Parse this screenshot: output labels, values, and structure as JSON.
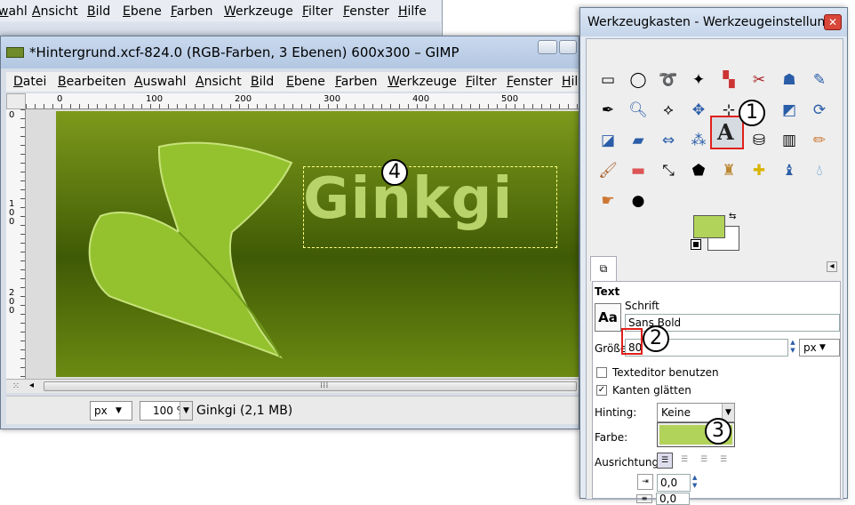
{
  "bg_window": {
    "menu": [
      "wahl",
      "Ansicht",
      "Bild",
      "Ebene",
      "Farben",
      "Werkzeuge",
      "Filter",
      "Fenster",
      "Hilfe"
    ]
  },
  "image_window": {
    "title": "*Hintergrund.xcf-824.0 (RGB-Farben, 3 Ebenen) 600x300 – GIMP",
    "menu": [
      "Datei",
      "Bearbeiten",
      "Auswahl",
      "Ansicht",
      "Bild",
      "Ebene",
      "Farben",
      "Werkzeuge",
      "Filter",
      "Fenster",
      "Hil"
    ],
    "ruler_h": [
      "0",
      "100",
      "200",
      "300",
      "400",
      "500"
    ],
    "ruler_v": [
      "0",
      "1\n0\n0",
      "2\n0\n0"
    ],
    "canvas_text": "Ginkgi",
    "status": {
      "unit": "px",
      "zoom": "100 %",
      "info": "Ginkgi (2,1 MB)"
    },
    "colors": {
      "canvas_top": "#7d9a1c",
      "canvas_dark": "#3f5a05",
      "text": "#b8d36a"
    }
  },
  "toolbox": {
    "title": "Werkzeugkasten - Werkzeugeinstellun...",
    "close": "✕",
    "tools": [
      "rect-select",
      "ellipse-select",
      "free-select",
      "fuzzy-select",
      "color-select",
      "scissors",
      "foreground-select",
      "paths",
      "color-picker",
      "zoom",
      "measure",
      "move",
      "align",
      "text",
      "bucket-fill",
      "blend",
      "pencil",
      "paintbrush",
      "eraser",
      "airbrush",
      "ink",
      "clone",
      "heal",
      "perspective-clone",
      "smudge",
      "dodge-burn",
      "crop",
      "rotate",
      "scale",
      "shear",
      "perspective",
      "flip",
      "cage"
    ],
    "fg_color": "#b2d35a",
    "bg_color": "#ffffff",
    "options": {
      "section": "Text",
      "font_label": "Schrift",
      "font_preview": "Aa",
      "font_value": "Sans Bold",
      "size_label": "Größe",
      "size_value": "80",
      "size_unit": "px",
      "editor_label": "Texteditor benutzen",
      "editor_checked": false,
      "antialias_label": "Kanten glätten",
      "antialias_checked": true,
      "hinting_label": "Hinting:",
      "hinting_value": "Keine",
      "color_label": "Farbe:",
      "color_value": "#b2d35a",
      "justify_label": "Ausrichtung:",
      "indent_value": "0,0",
      "spacing_value": "0,0"
    }
  },
  "annotations": [
    "1",
    "2",
    "3",
    "4"
  ]
}
